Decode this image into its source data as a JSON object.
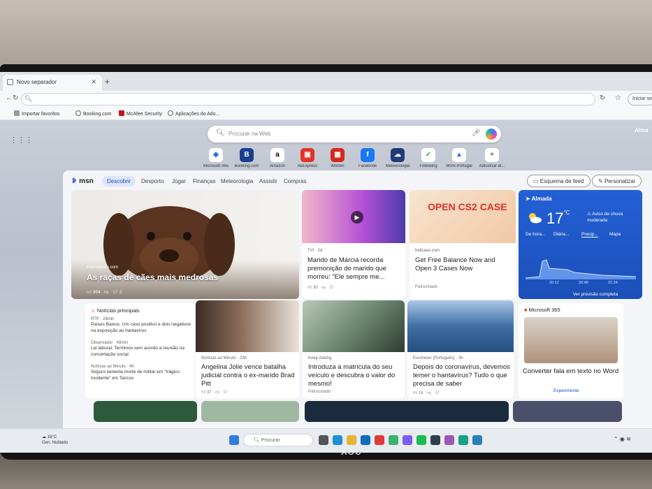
{
  "browser": {
    "tab_title": "Novo separador",
    "login_label": "Iniciar ses",
    "favorites": [
      "Importar favoritos",
      "Booking.com",
      "McAfee Security",
      "Aplicações do Ado..."
    ]
  },
  "ntp": {
    "search_placeholder": "Procurar na Web",
    "corner_name": "Alma",
    "quick_links": [
      "Microsoft 365",
      "Booking.com",
      "Amazon",
      "AliExpress",
      "Worten",
      "Facebook",
      "Meteorologia",
      "Following",
      "MSN Portugal",
      "Adicionar at..."
    ]
  },
  "feed": {
    "logo": "msn",
    "tabs": [
      "Descobrir",
      "Desporto",
      "Jogar",
      "Finanças",
      "Meteorologia",
      "Assistir",
      "Compras"
    ],
    "buttons": {
      "layout": "Esquema de feed",
      "personalize": "Personalizar"
    },
    "hero": {
      "source": "Petlondumo.com",
      "title": "As raças de cães mais medrosas",
      "likes": "394",
      "comments": "2"
    },
    "card_tvi": {
      "source": "TVI · 2d",
      "title": "Marido de Márcia recorda premonição do marido que morreu: \"Ele sempre me...",
      "likes": "30"
    },
    "card_hellcase": {
      "source": "hellcase.com",
      "banner": "OPEN CS2 CASE",
      "title": "Get Free Balance Now and Open 3 Cases Now",
      "tag": "Patrocinado"
    },
    "weather": {
      "location": "Almada",
      "temp": "17",
      "unit": "°C",
      "alert": "Aviso de chuva moderada",
      "tabs": [
        "De hora...",
        "Diária...",
        "Precip...",
        "Mapa"
      ],
      "times": [
        "20:12",
        "20:48",
        "21:24"
      ],
      "footer": "Ver previsão completa"
    },
    "top_news": {
      "header": "Notícias principais",
      "items": [
        {
          "source": "RTP · 28min",
          "text": "Países Baixos. Um caso positivo e dois negativos na exposição ao hantavírus"
        },
        {
          "source": "Observador · 48min",
          "text": "Lei laboral. Terminou sem acordo a reunião na concertação social"
        },
        {
          "source": "Notícias ao Minuto · 4h",
          "text": "Seguro lamenta morte de militar em \"trágico incidente\" em Tancos"
        }
      ]
    },
    "card_jolie": {
      "source": "Notícias ao Minuto · 23h",
      "title": "Angelina Jolie vence batalha judicial contra o ex-marido Brad Pitt",
      "likes": "37"
    },
    "card_car": {
      "source": "Keep Asking",
      "title": "Introduza a matrícula do seu veículo e descubra o valor do mesmo!",
      "tag": "Patrocinado"
    },
    "card_ship": {
      "source": "Euronews (Português) · 3h",
      "title": "Depois do coronavírus, devemos temer o hantavírus? Tudo o que precisa de saber",
      "likes": "16"
    },
    "card_m365": {
      "header": "Microsoft 365",
      "title": "Converter fala em texto no Word",
      "cta": "Experimente"
    }
  },
  "taskbar": {
    "search": "Procurar",
    "weather_temp": "18°C",
    "weather_desc": "Gen. Nublado"
  },
  "monitor_brand": "AOC",
  "colors": {
    "accent": "#2360d6",
    "msn_blue": "#4f6fe6",
    "hellcase_red": "#e0322b"
  }
}
